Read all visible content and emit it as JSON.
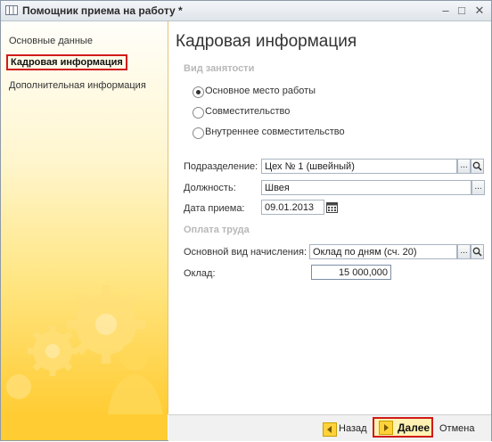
{
  "window": {
    "title": "Помощник приема на работу *"
  },
  "sidebar": {
    "items": [
      {
        "label": "Основные данные"
      },
      {
        "label": "Кадровая информация"
      },
      {
        "label": "Дополнительная информация"
      }
    ]
  },
  "main": {
    "title": "Кадровая информация",
    "employment_section": "Вид занятости",
    "employment_options": [
      {
        "label": "Основное место работы",
        "selected": true
      },
      {
        "label": "Совместительство",
        "selected": false
      },
      {
        "label": "Внутреннее совместительство",
        "selected": false
      }
    ],
    "fields": {
      "department_label": "Подразделение:",
      "department_value": "Цех № 1 (швейный)",
      "position_label": "Должность:",
      "position_value": "Швея",
      "hire_date_label": "Дата приема:",
      "hire_date_value": "09.01.2013"
    },
    "pay_section": "Оплата труда",
    "pay_fields": {
      "accrual_label": "Основной вид начисления:",
      "accrual_value": "Оклад по дням (сч. 20)",
      "salary_label": "Оклад:",
      "salary_value": "15 000,000"
    }
  },
  "footer": {
    "back_label": "Назад",
    "next_label": "Далее",
    "cancel_label": "Отмена"
  },
  "icons": {
    "select": "...",
    "search": "magnifier",
    "calendar": "calendar",
    "back": "triangle-left",
    "next": "triangle-right"
  },
  "colors": {
    "accent": "#ffcc33",
    "highlight_border": "#d11a1a"
  }
}
